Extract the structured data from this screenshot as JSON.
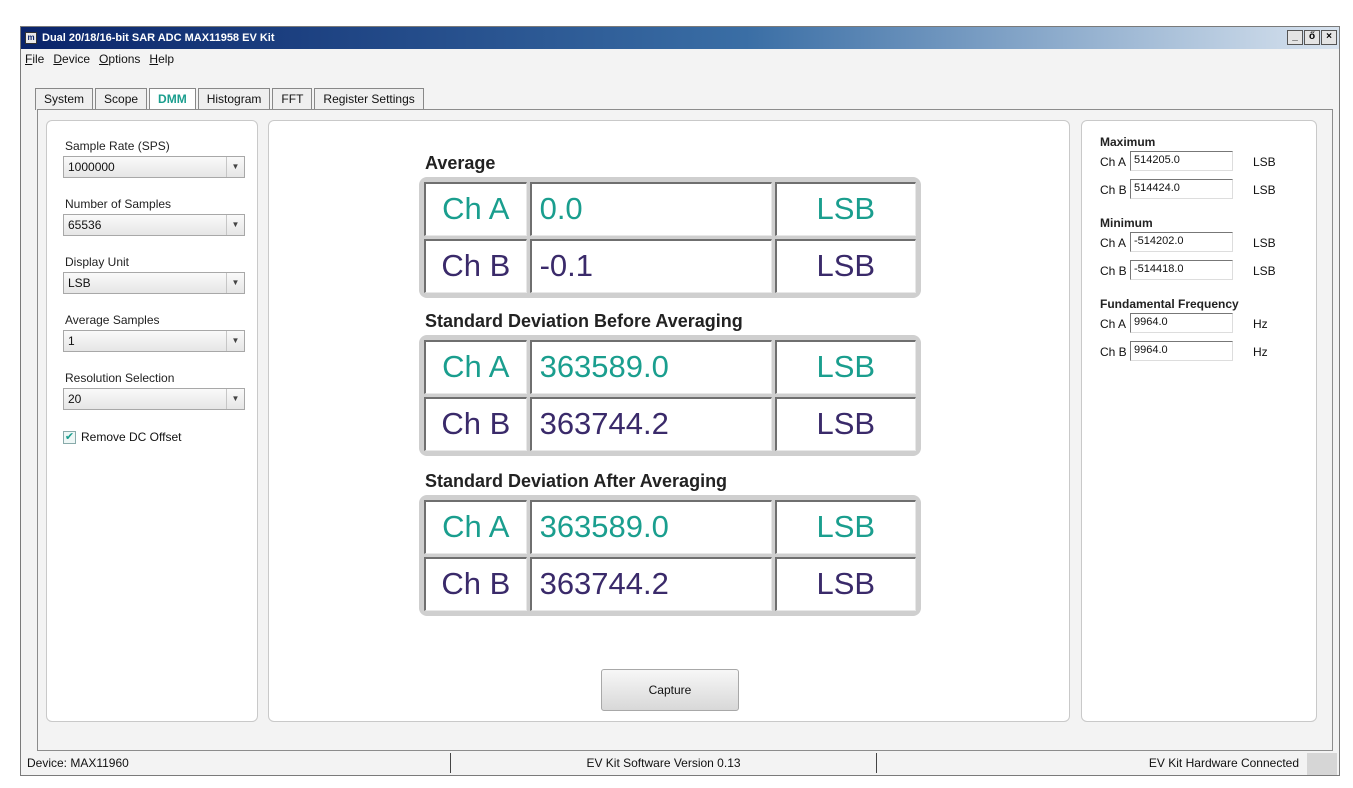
{
  "window": {
    "title": "Dual 20/18/16-bit SAR ADC MAX11958 EV Kit",
    "app_icon_text": "m",
    "buttons": {
      "minimize": "_",
      "restore": "ő",
      "close": "×"
    }
  },
  "menu": [
    {
      "label": "File",
      "underline": "F",
      "rest": "ile"
    },
    {
      "label": "Device",
      "underline": "D",
      "rest": "evice"
    },
    {
      "label": "Options",
      "underline": "O",
      "rest": "ptions"
    },
    {
      "label": "Help",
      "underline": "H",
      "rest": "elp"
    }
  ],
  "tabs": [
    "System",
    "Scope",
    "DMM",
    "Histogram",
    "FFT",
    "Register Settings"
  ],
  "active_tab": "DMM",
  "left_panel": {
    "sample_rate_label": "Sample Rate (SPS)",
    "sample_rate_value": "1000000",
    "num_samples_label": "Number of Samples",
    "num_samples_value": "65536",
    "display_unit_label": "Display Unit",
    "display_unit_value": "LSB",
    "average_samples_label": "Average Samples",
    "average_samples_value": "1",
    "resolution_label": "Resolution Selection",
    "resolution_value": "20",
    "remove_dc_label": "Remove DC Offset",
    "remove_dc_checked": true
  },
  "center_panel": {
    "sections": [
      {
        "title": "Average",
        "rows": [
          {
            "channel": "Ch A",
            "value": "0.0",
            "unit": "LSB"
          },
          {
            "channel": "Ch B",
            "value": "-0.1",
            "unit": "LSB"
          }
        ]
      },
      {
        "title": "Standard Deviation Before Averaging",
        "rows": [
          {
            "channel": "Ch A",
            "value": "363589.0",
            "unit": "LSB"
          },
          {
            "channel": "Ch B",
            "value": "363744.2",
            "unit": "LSB"
          }
        ]
      },
      {
        "title": "Standard Deviation After Averaging",
        "rows": [
          {
            "channel": "Ch A",
            "value": "363589.0",
            "unit": "LSB"
          },
          {
            "channel": "Ch B",
            "value": "363744.2",
            "unit": "LSB"
          }
        ]
      }
    ],
    "capture_label": "Capture"
  },
  "right_panel": {
    "maximum_title": "Maximum",
    "maximum": [
      {
        "channel": "Ch A",
        "value": "514205.0",
        "unit": "LSB"
      },
      {
        "channel": "Ch B",
        "value": "514424.0",
        "unit": "LSB"
      }
    ],
    "minimum_title": "Minimum",
    "minimum": [
      {
        "channel": "Ch A",
        "value": "-514202.0",
        "unit": "LSB"
      },
      {
        "channel": "Ch B",
        "value": "-514418.0",
        "unit": "LSB"
      }
    ],
    "fundamental_title": "Fundamental Frequency",
    "fundamental": [
      {
        "channel": "Ch A",
        "value": "9964.0",
        "unit": "Hz"
      },
      {
        "channel": "Ch B",
        "value": "9964.0",
        "unit": "Hz"
      }
    ]
  },
  "status_bar": {
    "device": "Device: MAX11960",
    "version": "EV Kit Software Version 0.13",
    "connection": "EV Kit Hardware Connected"
  },
  "colors": {
    "accent": "#1a9e8e",
    "ch_b": "#3a2a6a"
  }
}
